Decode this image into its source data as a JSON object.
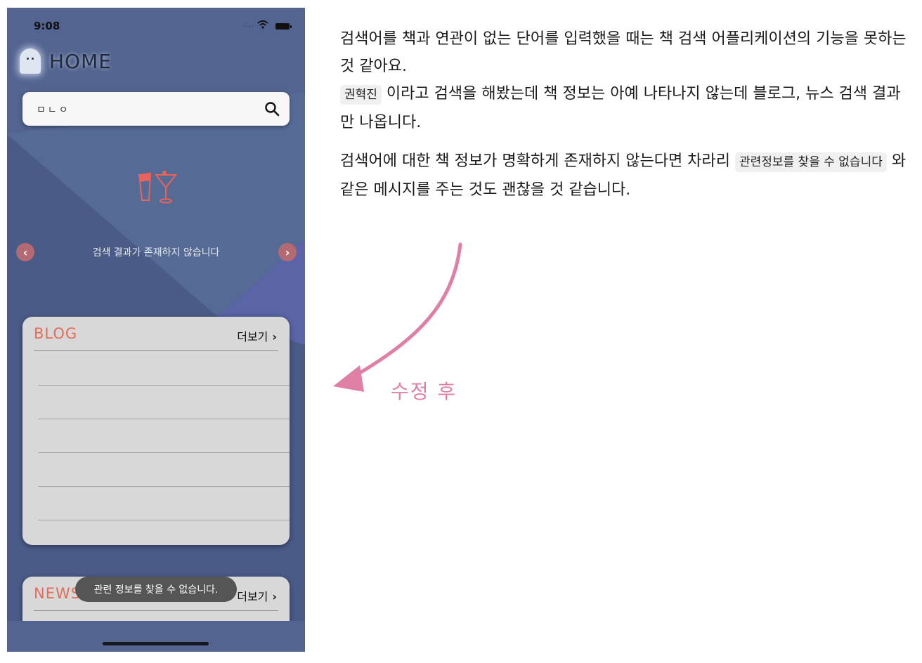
{
  "status_bar": {
    "time": "9:08"
  },
  "header": {
    "title": "HOME"
  },
  "search": {
    "value": "ㅁㄴㅇ"
  },
  "results": {
    "empty_message": "검색 결과가 존재하지 않습니다"
  },
  "blog": {
    "title": "BLOG",
    "more": "더보기"
  },
  "news": {
    "title": "NEWS",
    "more": "더보기"
  },
  "toast": {
    "message": "관련 정보를 찾을 수 없습니다."
  },
  "comment": {
    "p1_part1": "검색어를 책과 연관이 없는 단어를 입력했을 때는 책 검색 어플리케이션의 기능을 못하는 것 같아요.",
    "p1_code": "권혁진",
    "p1_part2": " 이라고 검색을 해봤는데 책 정보는 아예 나타나지 않는데 블로그, 뉴스 검색 결과만 나옵니다.",
    "p2_part1": "검색어에 대한 책 정보가 명확하게 존재하지 않는다면 차라리 ",
    "p2_code": "관련정보를 찾을 수 없습니다",
    "p2_part2": " 와 같은 메시지를 주는 것도 괜찮을 것 같습니다."
  },
  "annotation": {
    "label": "수정 후"
  },
  "colors": {
    "phone_bg": "#52648f",
    "accent_title": "#e06e5a",
    "nav_button": "#b46a73",
    "annotation": "#e07fa6"
  },
  "icons": [
    "search-icon",
    "chevron-left-icon",
    "chevron-right-icon",
    "chevron-right-icon",
    "ghost-logo-icon",
    "cocktail-icon",
    "wifi-icon",
    "battery-icon"
  ]
}
